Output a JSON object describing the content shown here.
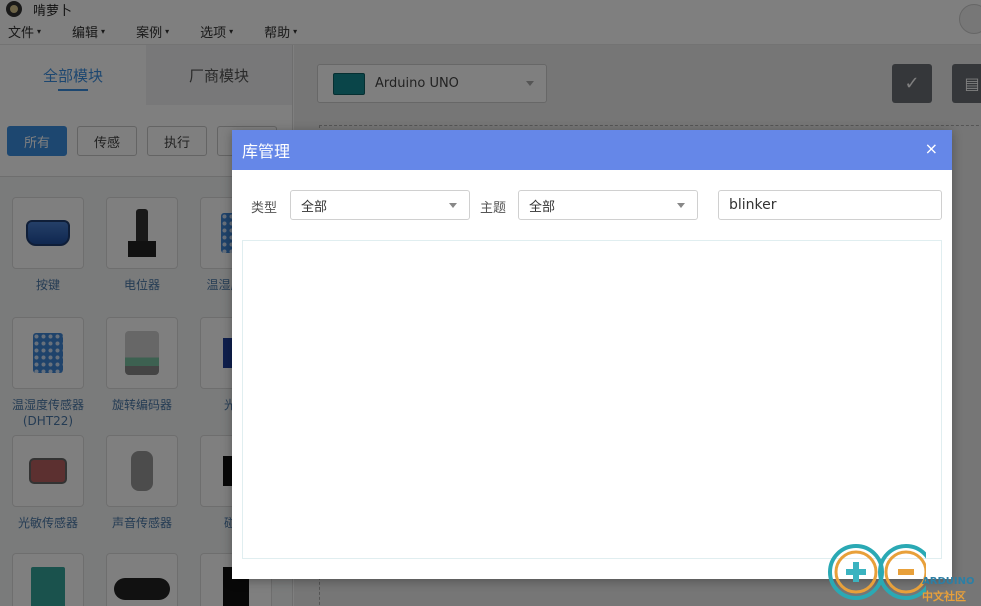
{
  "app": {
    "title": "啃萝卜"
  },
  "menu": [
    {
      "label": "文件"
    },
    {
      "label": "编辑"
    },
    {
      "label": "案例"
    },
    {
      "label": "选项"
    },
    {
      "label": "帮助"
    }
  ],
  "left_panel": {
    "tabs": [
      {
        "label": "全部模块",
        "active": true
      },
      {
        "label": "厂商模块",
        "active": false
      }
    ],
    "filters": [
      {
        "label": "所有",
        "active": true
      },
      {
        "label": "传感"
      },
      {
        "label": "执行"
      }
    ],
    "modules": [
      {
        "label": "按键",
        "icon": "button-module"
      },
      {
        "label": "电位器",
        "icon": "potentiometer-module"
      },
      {
        "label": "温湿度(DH",
        "icon": "dht11-module"
      },
      {
        "label": "温湿度传感器(DHT22)",
        "icon": "dht22-module"
      },
      {
        "label": "旋转编码器",
        "icon": "rotary-encoder-module"
      },
      {
        "label": "光电",
        "icon": "photoelectric-module"
      },
      {
        "label": "光敏传感器",
        "icon": "photoresistor-module"
      },
      {
        "label": "声音传感器",
        "icon": "sound-sensor-module"
      },
      {
        "label": "碰撞",
        "icon": "collision-module"
      },
      {
        "label": "",
        "icon": "green-module"
      },
      {
        "label": "",
        "icon": "ultrasonic-module"
      },
      {
        "label": "",
        "icon": "dark-module"
      }
    ]
  },
  "main": {
    "board_select": {
      "value": "Arduino UNO"
    },
    "verify_icon": "checkmark-icon",
    "upload_icon": "save-icon"
  },
  "modal": {
    "title": "库管理",
    "close_symbol": "×",
    "type_label": "类型",
    "type_value": "全部",
    "topic_label": "主题",
    "topic_value": "全部",
    "search_value": "blinker"
  },
  "watermark": {
    "line1": "ARDUINO",
    "line2": "中文社区"
  },
  "colors": {
    "accent": "#3b8ee0",
    "modal_header": "#6587e8",
    "overlay": "rgba(0,0,0,0.5)"
  }
}
